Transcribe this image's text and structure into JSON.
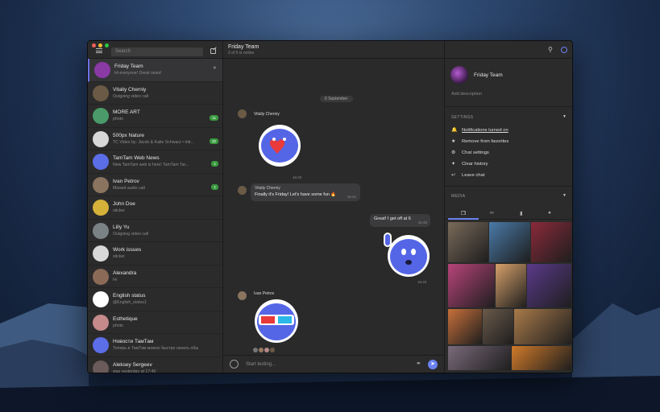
{
  "sidebar": {
    "search_placeholder": "Search",
    "chats": [
      {
        "name": "Friday Team",
        "preview": "Hi everyone! Great news!",
        "badge": "",
        "pinned": true,
        "avatar_color": "#8a3aa5"
      },
      {
        "name": "Vitaliy Cherniy",
        "preview": "Outgoing video call",
        "badge": "",
        "avatar_color": "#6b5a46"
      },
      {
        "name": "MORE ART",
        "preview": "photo",
        "badge": "11",
        "avatar_color": "#4a9a6a"
      },
      {
        "name": "500px Nature",
        "preview": "TC Video by: Jacob & Katie Schwarz • Intr...",
        "badge": "32",
        "avatar_color": "#d8d8d8"
      },
      {
        "name": "TamTam Web News",
        "preview": "New TamTam web is here! TamTam Tar...",
        "badge": "1",
        "avatar_color": "#5c6de8"
      },
      {
        "name": "Ivan Petrov",
        "preview": "Missed audio call",
        "badge": "1",
        "avatar_color": "#8a7460"
      },
      {
        "name": "John Doe",
        "preview": "sticker",
        "badge": "",
        "avatar_color": "#d6b13a"
      },
      {
        "name": "Lilly Yu",
        "preview": "Outgoing video call",
        "badge": "",
        "avatar_color": "#7a8286"
      },
      {
        "name": "Work issues",
        "preview": "sticker",
        "badge": "",
        "avatar_color": "#d8d8d8"
      },
      {
        "name": "Alexandra",
        "preview": "Hi",
        "badge": "",
        "avatar_color": "#8c6a58"
      },
      {
        "name": "English status",
        "preview": "@English_status1",
        "badge": "",
        "avatar_color": "#ffffff"
      },
      {
        "name": "Esthetique",
        "preview": "photo",
        "badge": "",
        "avatar_color": "#c58a8a"
      },
      {
        "name": "Новости ТамТам",
        "preview": "Теперь в ТамТам можно быстро начать общать...",
        "badge": "",
        "avatar_color": "#5c6de8"
      },
      {
        "name": "Aleksey Sergeev",
        "preview": "was yesterday at 17:40",
        "badge": "",
        "avatar_color": "#6a5a5a"
      }
    ]
  },
  "main": {
    "title": "Friday Team",
    "subtitle": "2 of 6 is online",
    "date": "6 September",
    "messages": {
      "m1_sender": "Vitaliy Cherniy",
      "m1_time": "16:40",
      "m2_sender": "Vitaliy Cherniy",
      "m2_text": "Finally it's Friday! Let's have some fun 🔥",
      "m2_time": "16:41",
      "m3_text": "Great! I get off at 6",
      "m3_time": "16:45",
      "m4_time": "16:45",
      "m5_sender": "Ivan Petrov"
    },
    "composer_placeholder": "Start texting..."
  },
  "info": {
    "group_name": "Friday Team",
    "add_description": "Add description",
    "settings_label": "SETTINGS",
    "settings": {
      "notifications": "Notifications turned on",
      "favorites": "Remove from favorites",
      "chat_settings": "Chat settings",
      "clear_history": "Clear history",
      "leave": "Leave chat"
    },
    "media_label": "MEDIA"
  },
  "colors": {
    "accent": "#6a82f2",
    "badge": "#3a9a3f"
  }
}
